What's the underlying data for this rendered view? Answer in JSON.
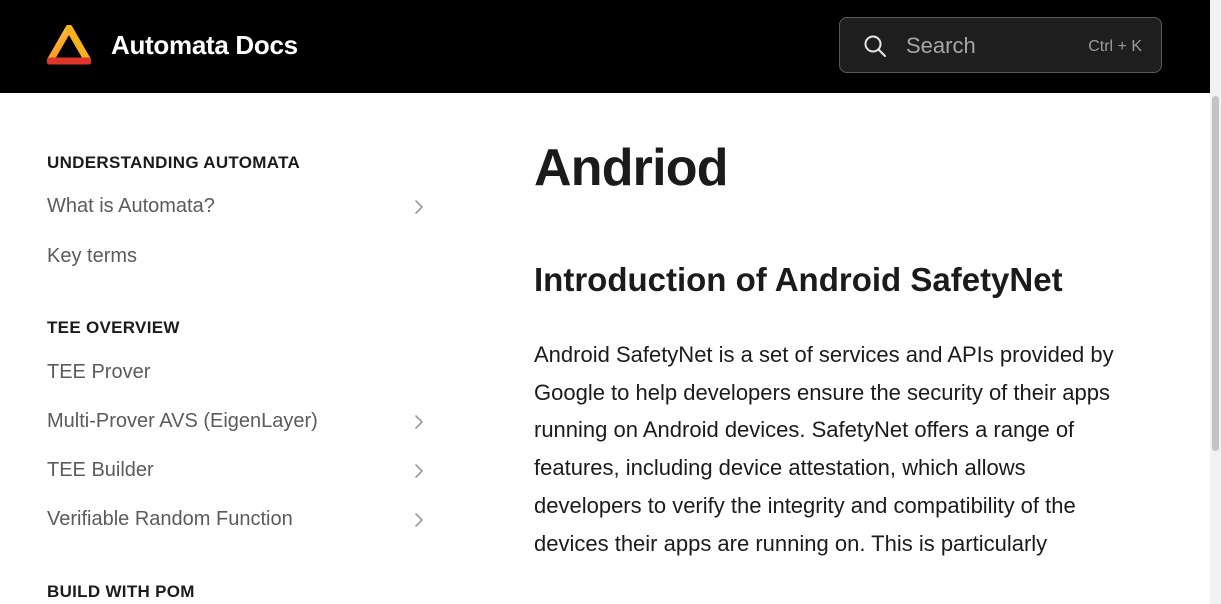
{
  "header": {
    "site_title": "Automata Docs",
    "logo": "automata-logo",
    "search": {
      "placeholder": "Search",
      "shortcut": "Ctrl + K",
      "icon": "search-icon"
    }
  },
  "sidebar": {
    "sections": [
      {
        "title": "UNDERSTANDING AUTOMATA",
        "items": [
          {
            "label": "What is Automata?",
            "expandable": true
          },
          {
            "label": "Key terms",
            "expandable": false
          }
        ]
      },
      {
        "title": "TEE OVERVIEW",
        "items": [
          {
            "label": "TEE Prover",
            "expandable": false
          },
          {
            "label": "Multi-Prover AVS (EigenLayer)",
            "expandable": true
          },
          {
            "label": "TEE Builder",
            "expandable": true
          },
          {
            "label": "Verifiable Random Function",
            "expandable": true
          }
        ]
      },
      {
        "title": "BUILD WITH POM",
        "items": []
      }
    ]
  },
  "main": {
    "title": "Andriod",
    "heading": "Introduction of Android SafetyNet",
    "paragraph": "Android SafetyNet is a set of services and APIs provided by Google to help developers ensure the security of their apps running on Android devices. SafetyNet offers a range of features, including device attestation, which allows developers to verify the integrity and compatibility of the devices their apps are running on. This is particularly"
  },
  "colors": {
    "header_bg": "#000000",
    "text": "#1b1b1b",
    "muted_text": "#5b5b5b"
  }
}
